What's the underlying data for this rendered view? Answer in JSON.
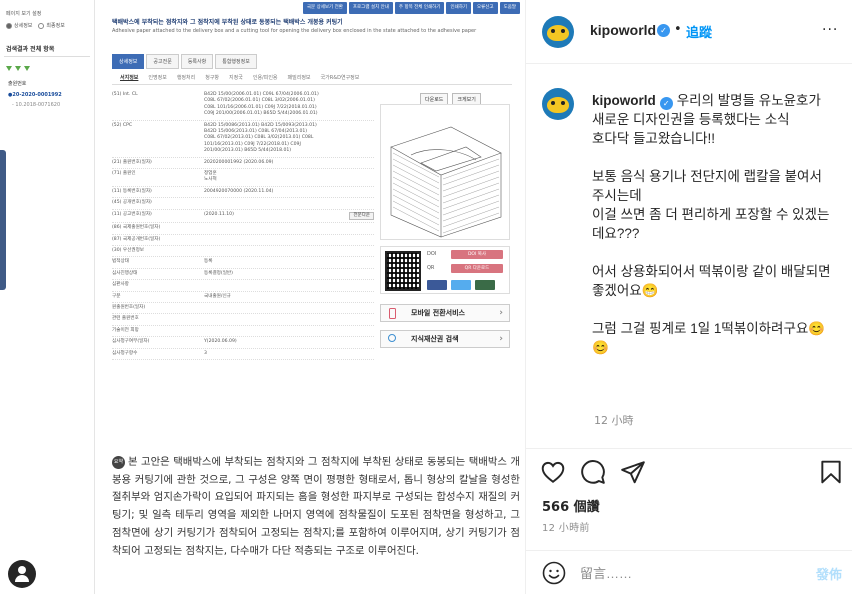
{
  "post_image": {
    "left_panel": {
      "view_mode_label": "페이지 보기 설정",
      "view_options": [
        "상세정보",
        "최종정보"
      ],
      "section_header": "검색결과 전체 항목",
      "section_label": "출원번호",
      "application_number": "●20-2020-0001992",
      "application_date": "- 10.2018-0071620"
    },
    "top_buttons": [
      "국문 상세보기 전환",
      "프로그램 설치 안내",
      "주 항목 전체 인쇄하기",
      "인쇄하기",
      "오류신고",
      "도움말"
    ],
    "title": "택배박스에 부착되는 점착지와 그 점착지에 부착된 상태로 동봉되는 택배박스 개봉용 커팅기",
    "subtitle": "Adhesive paper attached to the delivery box and a cutting tool for opening the delivery box enclosed in the state attached to the adhesive paper",
    "tabs": [
      "상세정보",
      "공고전문",
      "등록사항",
      "통합행정정보"
    ],
    "subtabs": [
      "서지정보",
      "인명정보",
      "행정처리",
      "청구항",
      "지정국",
      "인용/피인용",
      "패밀리정보",
      "국가R&D연구정보"
    ],
    "doc_buttons": [
      "다운로드",
      "크게보기"
    ],
    "rows": [
      {
        "label": "(51) Int. CL",
        "value": "B42D 15/00(2006.01.01) C09L 67/04(2006.01.01)\nC08L 67/02(2006.01.01) C08L 3/02(2006.01.01)\nC08L 101/16(2006.01.01) C09J 7/22(2018.01.01)\nC09J 201/00(2006.01.01) B65D 5/44(2006.01.01)"
      },
      {
        "label": "(52) CPC",
        "value": "B42D 15/0086(2013.01) B42D 15/0093(2013.01)\nB42D 15/006(2013.01) C08L 67/04(2013.01)\nC08L 67/02(2013.01) C08L 3/02(2013.01) C08L\n101/16(2013.01) C09J 7/22(2018.01) C09J\n201/00(2013.01) B65D 5/44(2018.01)"
      },
      {
        "label": "(21) 출원번호(일자)",
        "value": "2020200001992 (2020.06.09)"
      },
      {
        "label": "(71) 출원인",
        "value": "정업훈\n노사혁"
      },
      {
        "label": "(11) 등록번호(일자)",
        "value": "2004920070000 (2020.11.04)"
      },
      {
        "label": "(45) 공개번호(일자)",
        "value": ""
      },
      {
        "label": "(11) 공고번호(일자)",
        "value": "(2020.11.10)"
      },
      {
        "label": "(86) 국제출원번호(일자)",
        "value": ""
      },
      {
        "label": "(87) 국제공개번호(일자)",
        "value": ""
      },
      {
        "label": "(30) 우선권정보",
        "value": ""
      },
      {
        "label": "법적상태",
        "value": "등록"
      },
      {
        "label": "심사진행상태",
        "value": "등록결정(일반)"
      },
      {
        "label": "심판사항",
        "value": ""
      },
      {
        "label": "구분",
        "value": "국내출원/신규"
      },
      {
        "label": "원출원번호(일자)",
        "value": ""
      },
      {
        "label": "관련 출원번호",
        "value": ""
      },
      {
        "label": "기술이전 희망",
        "value": ""
      },
      {
        "label": "심사청구여부(일자)",
        "value": "Y(2020.06.09)"
      },
      {
        "label": "심사청구항수",
        "value": "3"
      }
    ],
    "public_btn": "전문다운",
    "qr_labels": [
      "DOI",
      "QR"
    ],
    "qr_buttons": [
      "DOI 복사",
      "QR 다운로드"
    ],
    "mobile_service": "모바일 전환서비스",
    "ip_search": "지식재산권 검색",
    "abstract_tag": "요약",
    "abstract": "본 고안은 택배박스에 부착되는 점착지와 그 점착지에 부착된 상태로 동봉되는 택배박스 개봉용 커팅기에 관한 것으로, 그 구성은 양쪽 면이 평평한 형태로서, 톱니 형상의 칼날을 형성한 절취부와 엄지손가락이 요입되어 파지되는 홈을 형성한 파지부로 구성되는 합성수지 재질의 커팅기; 및 일측 테두리 영역을 제외한 나머지 영역에 점착물질이 도포된 점착면을 형성하고, 그 점착면에 상기 커팅기가 점착되어 고정되는 점착지;를 포함하여 이루어지며, 상기 커팅기가 점착되어 고정되는 점착지는, 다수매가 다단 적층되는 구조로 이루어진다."
  },
  "instagram": {
    "username": "kipoworld",
    "follow_label": "追蹤",
    "dot_separator": "•",
    "more_label": "···",
    "caption_username": "kipoworld",
    "caption": "우리의 발명들 유노윤호가 새로운 디자인권을 등록했다는 소식\n호다닥 들고왔습니다!!\n\n보통 음식 용기나 전단지에 랩칼을 붙여서 주시는데\n이걸 쓰면 좀 더 편리하게 포장할 수 있겠는데요???\n\n어서 상용화되어서 떡볶이랑 같이 배달되면 좋겠어요😁\n\n그럼 그걸 핑계로 1일 1떡볶이하려구요😊😊",
    "caption_time": "12 小時",
    "likes": "566 個讚",
    "time_ago": "12 小時前",
    "comment_placeholder": "留言……",
    "post_label": "發佈",
    "colors": {
      "link": "#0095f6",
      "muted": "#8e8e8e",
      "verified": "#3897f0"
    }
  }
}
